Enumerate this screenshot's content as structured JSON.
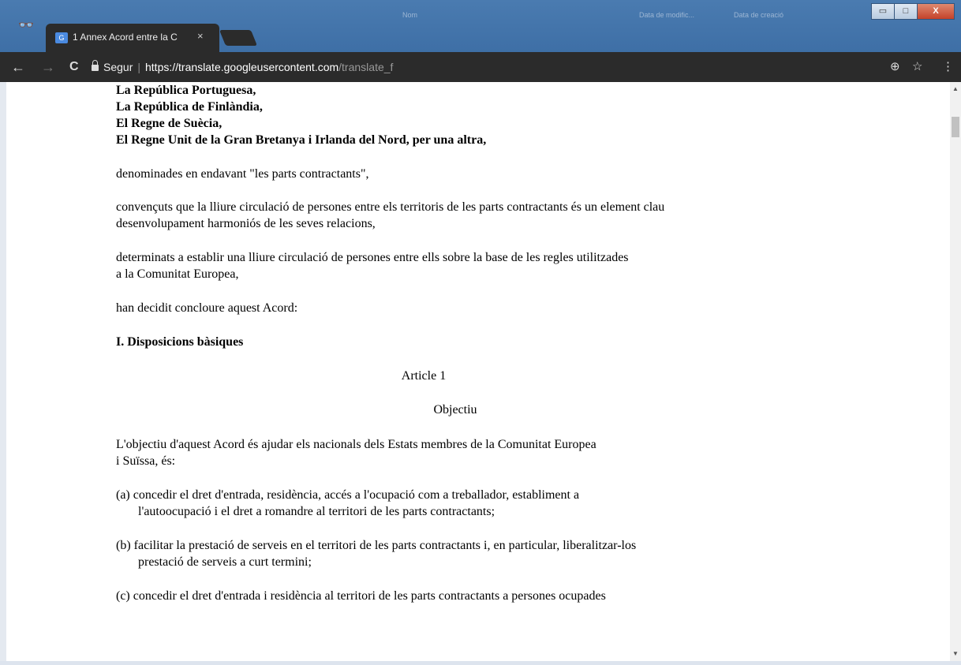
{
  "browser": {
    "tab_title": "1 Annex Acord entre la C",
    "tab_close": "×",
    "bg_text": [
      "Nom",
      "Data de modific...",
      "Data de creació"
    ],
    "window_buttons": [
      "▭",
      "□",
      "X"
    ]
  },
  "toolbar": {
    "back": "←",
    "forward": "→",
    "reload": "C",
    "security_label": "Segur",
    "url_scheme": "https://",
    "url_host": "translate.googleusercontent.com",
    "url_path": "/translate_f",
    "zoom_icon": "⊕",
    "star_icon": "☆",
    "menu_icon": "⋮"
  },
  "document": {
    "parties": [
      "La República Portuguesa,",
      "La República de Finlàndia,",
      "El Regne de Suècia,",
      "El Regne Unit de la Gran Bretanya i Irlanda del Nord, per una altra,"
    ],
    "p1": "denominades en endavant \"les parts contractants\",",
    "p2a": "convençuts que la lliure circulació de persones entre els territoris de les parts contractants és un element clau",
    "p2b": "desenvolupament harmoniós de les seves relacions,",
    "p3a": "determinats a establir una lliure circulació de persones entre ells sobre la base de les regles utilitzades",
    "p3b": "a la Comunitat Europea,",
    "p4": "han decidit concloure aquest Acord:",
    "section": "I. Disposicions bàsiques",
    "article": "Article 1",
    "article_title": "Objectiu",
    "p5a": "L'objectiu d'aquest Acord és ajudar els nacionals dels Estats membres de la Comunitat Europea",
    "p5b": "i Suïssa, és:",
    "a1": "(a) concedir el dret d'entrada, residència, accés a l'ocupació com a treballador, establiment a",
    "a2": "l'autoocupació i el dret a romandre al territori de les parts contractants;",
    "b1": "(b) facilitar la prestació de serveis en el territori de les parts contractants i, en particular, liberalitzar-los",
    "b2": "prestació de serveis a curt termini;",
    "c1": "(c) concedir el dret d'entrada i residència al territori de les parts contractants a persones ocupades"
  }
}
